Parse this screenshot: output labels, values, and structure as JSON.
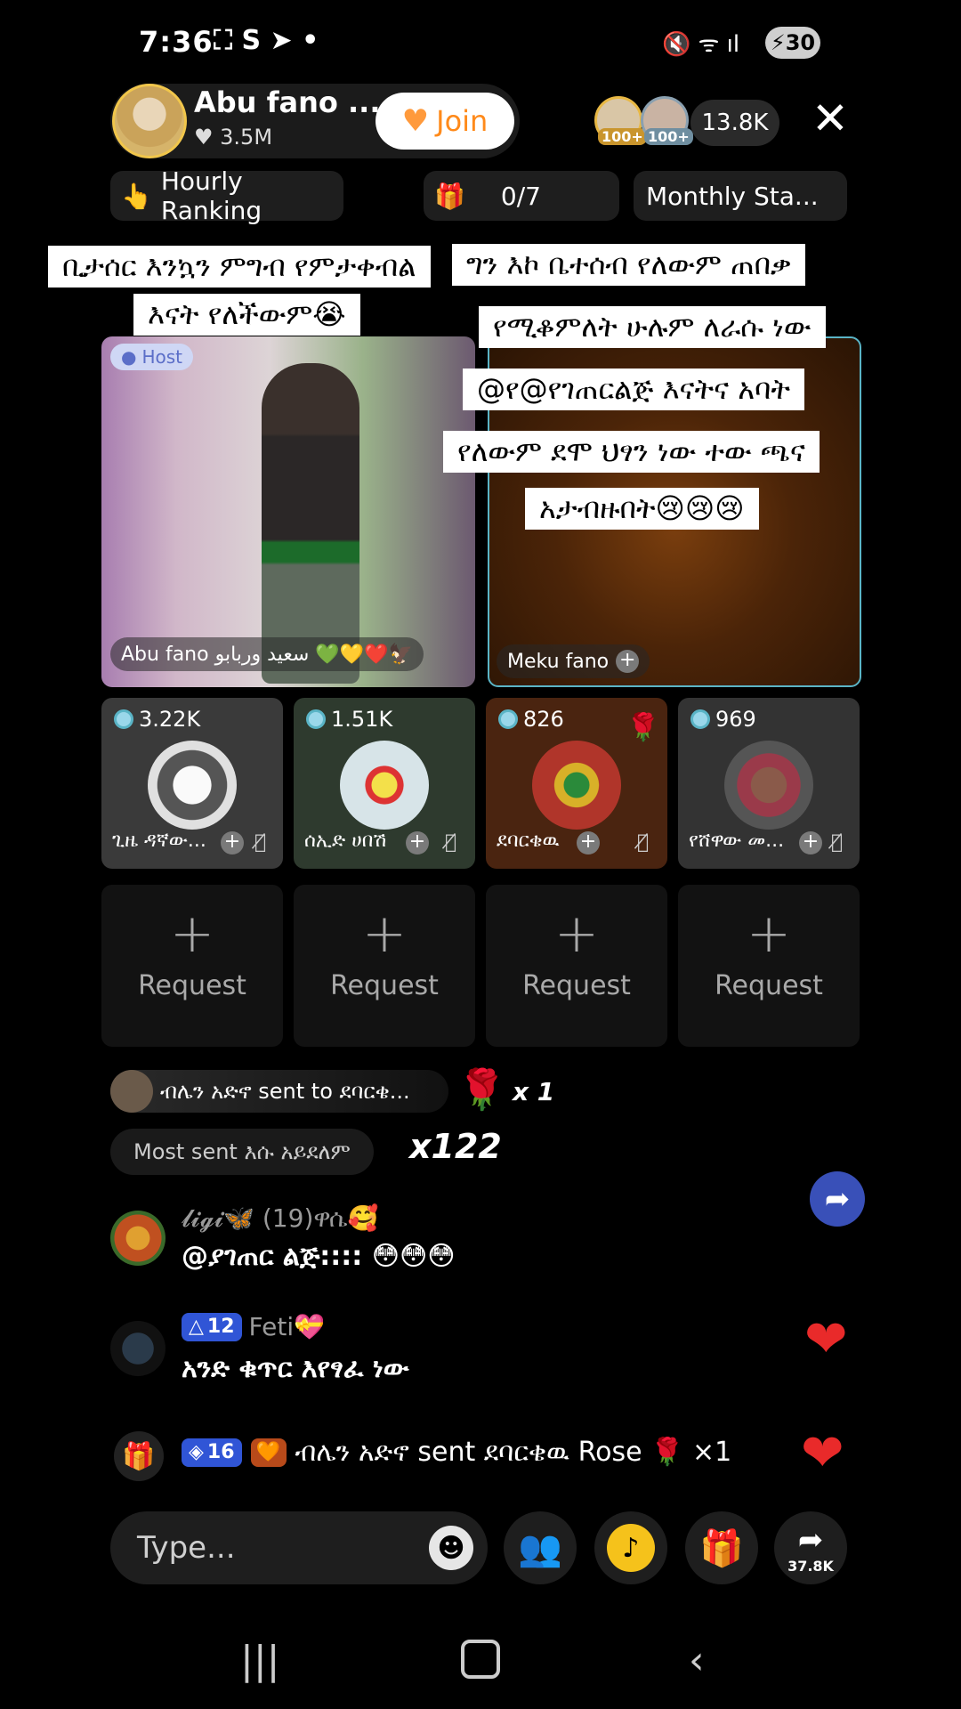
{
  "status_bar": {
    "time": "7:36",
    "left_icons": "⛶ S ➤ •",
    "right_icons": "🔇 ᯤ ıl",
    "battery": "30"
  },
  "header": {
    "host_name": "Abu fano ...",
    "host_likes": "3.5M",
    "join_label": "Join",
    "viewer_badge_1": "100+",
    "viewer_badge_2": "100+",
    "viewer_count": "13.8K",
    "hourly_ranking": "Hourly Ranking",
    "progress": "0/7",
    "monthly": "Monthly Sta..."
  },
  "captions": {
    "left_line1": "ቢታሰር እንኳን ምግብ የምታቀብል",
    "left_line2": "እናት የለችውም😭",
    "right_line1": "ግን እኮ ቤተሰብ የለውም ጠበቃ",
    "right_line2": "የሚቆምለት ሁሉም ለራሱ ነው",
    "right_line3": "@የ@የገጠርልጅ እናትና አባት",
    "right_line4": "የለውም ደሞ ህፃን ነው ተው ጫና",
    "right_line5": "አታብዙበት😢😢😢"
  },
  "panes": {
    "host_tag": "Host",
    "left_name": "Abu fano سعيد وربابو 💚💛❤️🦅",
    "right_name": "Meku fano"
  },
  "guests": [
    {
      "count": "3.22K",
      "name": "ጊዜ ዳኛው...",
      "avatar_color": "#d8d8d8",
      "bg": "#3a3a3a"
    },
    {
      "count": "1.51K",
      "name": "ሰኢድ ሀበሽ",
      "avatar_color": "#cfe0e6",
      "bg": "#2b3b2b"
    },
    {
      "count": "826",
      "name": "ደባርቄዉ",
      "avatar_color": "#9b4a2a",
      "bg": "#4a2410"
    },
    {
      "count": "969",
      "name": "የሸዋው መ...",
      "avatar_color": "#5b3a3a",
      "bg": "#333"
    }
  ],
  "request_label": "Request",
  "chat": {
    "gift_banner": "ብሌን አድኖ sent to ደባርቄ...",
    "gift_banner_count": "x 1",
    "most_sent": "Most sent እሱ አይደለም",
    "most_sent_count": "x122",
    "msg1_user": "𝓵𝓲𝓰𝓲🦋 (19)ዋሴ🥰",
    "msg1_text": "@ያገጠር ልጅ:::: 😳😳😳",
    "msg2_level": "12",
    "msg2_user": "Feti💝",
    "msg2_text": "አንድ ቁጥር እየፃፈ ነው",
    "msg3_level": "16",
    "msg3_text": "ብሌን አድኖ sent ደባርቄዉ Rose 🌹 ×1"
  },
  "bottom": {
    "placeholder": "Type...",
    "share_count": "37.8K"
  }
}
